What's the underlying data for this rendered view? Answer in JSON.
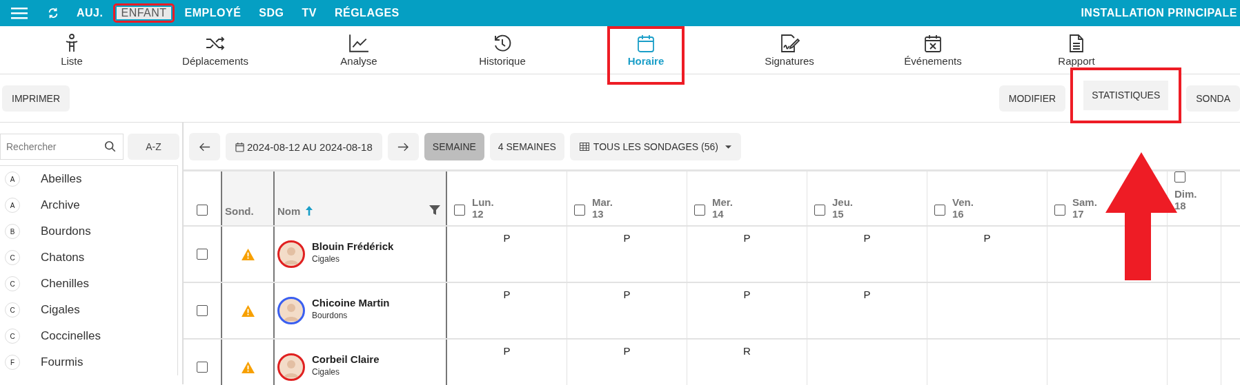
{
  "top_bar": {
    "items": [
      {
        "label": "AUJ.",
        "selected": false,
        "highlighted": false
      },
      {
        "label": "ENFANT",
        "selected": true,
        "highlighted": true
      },
      {
        "label": "EMPLOYÉ",
        "selected": false,
        "highlighted": false
      },
      {
        "label": "SDG",
        "selected": false,
        "highlighted": false
      },
      {
        "label": "TV",
        "selected": false,
        "highlighted": false
      },
      {
        "label": "RÉGLAGES",
        "selected": false,
        "highlighted": false
      }
    ],
    "location": "INSTALLATION PRINCIPALE"
  },
  "nav_tabs": [
    {
      "kind": "person",
      "label": "Liste",
      "selected": false,
      "highlighted": false
    },
    {
      "kind": "shuffle",
      "label": "Déplacements",
      "selected": false,
      "highlighted": false
    },
    {
      "kind": "chart",
      "label": "Analyse",
      "selected": false,
      "highlighted": false
    },
    {
      "kind": "history",
      "label": "Historique",
      "selected": false,
      "highlighted": false
    },
    {
      "kind": "calendar",
      "label": "Horaire",
      "selected": true,
      "highlighted": true
    },
    {
      "kind": "signature",
      "label": "Signatures",
      "selected": false,
      "highlighted": false
    },
    {
      "kind": "event",
      "label": "Événements",
      "selected": false,
      "highlighted": false
    },
    {
      "kind": "report",
      "label": "Rapport",
      "selected": false,
      "highlighted": false
    }
  ],
  "actions": {
    "left": [
      {
        "label": "IMPRIMER",
        "highlighted": false
      }
    ],
    "right": [
      {
        "label": "MODIFIER",
        "highlighted": false
      },
      {
        "label": "STATISTIQUES",
        "highlighted": true
      },
      {
        "label": "SONDA",
        "highlighted": false
      }
    ]
  },
  "sidebar": {
    "search": {
      "placeholder": "Rechercher"
    },
    "sort_button": "A-Z",
    "items": [
      {
        "badge": "A",
        "label": "Abeilles"
      },
      {
        "badge": "A",
        "label": "Archive"
      },
      {
        "badge": "B",
        "label": "Bourdons"
      },
      {
        "badge": "C",
        "label": "Chatons"
      },
      {
        "badge": "C",
        "label": "Chenilles"
      },
      {
        "badge": "C",
        "label": "Cigales"
      },
      {
        "badge": "C",
        "label": "Coccinelles"
      },
      {
        "badge": "F",
        "label": "Fourmis"
      }
    ]
  },
  "schedule_toolbar": {
    "date_range": "2024-08-12 AU 2024-08-18",
    "views": [
      {
        "label": "SEMAINE",
        "selected": true
      },
      {
        "label": "4 SEMAINES",
        "selected": false
      }
    ],
    "filter": "TOUS LES SONDAGES (56)"
  },
  "table": {
    "select_all_checked": false,
    "columns": {
      "survey": "Sond.",
      "name": "Nom"
    },
    "days": [
      {
        "day": "Lun.",
        "date": "12",
        "checked": false
      },
      {
        "day": "Mar.",
        "date": "13",
        "checked": false
      },
      {
        "day": "Mer.",
        "date": "14",
        "checked": false
      },
      {
        "day": "Jeu.",
        "date": "15",
        "checked": false
      },
      {
        "day": "Ven.",
        "date": "16",
        "checked": false
      },
      {
        "day": "Sam.",
        "date": "17",
        "checked": false
      },
      {
        "day": "Dim.",
        "date": "18",
        "checked": false
      }
    ],
    "rows": [
      {
        "checked": false,
        "warning": true,
        "name": "Blouin Frédérick",
        "group": "Cigales",
        "color": "#e02020",
        "cells": [
          "P",
          "P",
          "P",
          "P",
          "P",
          "",
          ""
        ]
      },
      {
        "checked": false,
        "warning": true,
        "name": "Chicoine Martin",
        "group": "Bourdons",
        "color": "#3a5ff0",
        "cells": [
          "P",
          "P",
          "P",
          "P",
          "",
          "",
          ""
        ]
      },
      {
        "checked": false,
        "warning": true,
        "name": "Corbeil Claire",
        "group": "Cigales",
        "color": "#e02020",
        "cells": [
          "P",
          "P",
          "R",
          "",
          "",
          "",
          ""
        ]
      }
    ]
  }
}
